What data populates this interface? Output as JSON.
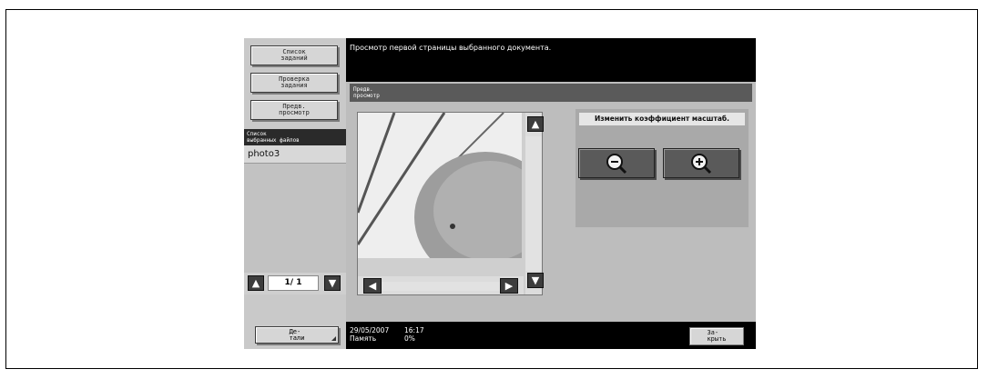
{
  "sidebar": {
    "buttons": [
      {
        "label": "Список\nзаданий"
      },
      {
        "label": "Проверка\nзадания"
      },
      {
        "label": "Предв.\nпросмотр"
      }
    ],
    "selected_files_header": "Список\nвыбранных файлов",
    "files": [
      "photo3"
    ],
    "pager": {
      "text": "1/  1"
    },
    "details_label": "Де-\nтали"
  },
  "message": "Просмотр первой страницы выбранного документа.",
  "preview": {
    "header": "Предв.\nпросмотр"
  },
  "zoom": {
    "label": "Изменить коэффициент масштаб.",
    "zoom_out_icon": "magnifier-minus-icon",
    "zoom_in_icon": "magnifier-plus-icon"
  },
  "status": {
    "date": "29/05/2007",
    "time": "16:17",
    "memory_label": "Память",
    "memory_value": "0%",
    "close_label": "За-\nкрыть"
  }
}
